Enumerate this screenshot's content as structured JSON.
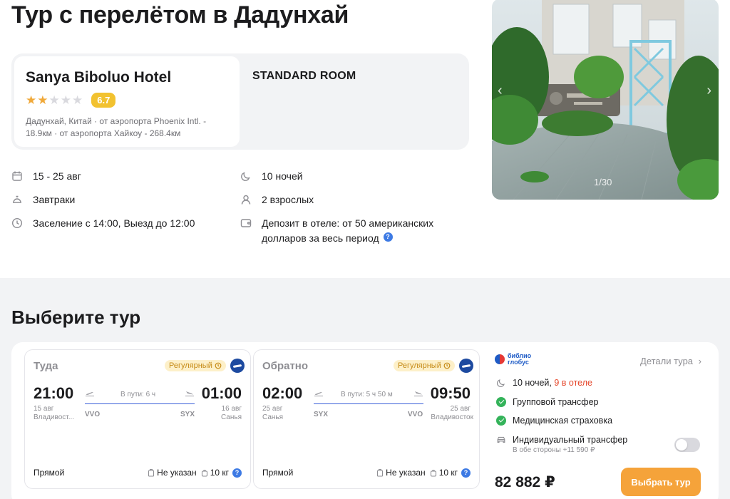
{
  "page": {
    "title": "Тур с перелётом в Дадунхай"
  },
  "hotel": {
    "name": "Sanya Biboluo Hotel",
    "stars": 2,
    "stars_max": 5,
    "score": "6.7",
    "location": "Дадунхай, Китай · от аэропорта Phoenix Intl. - 18.9км · от аэропорта Хайкоу - 268.4км",
    "room": "STANDARD ROOM"
  },
  "info": {
    "dates": "15 - 25 авг",
    "nights": "10 ночей",
    "meals": "Завтраки",
    "guests": "2 взрослых",
    "checkin": "Заселение с 14:00, Выезд до 12:00",
    "deposit": "Депозит в отеле: от 50 американских долларов за весь период",
    "deposit_help": "?"
  },
  "photo": {
    "counter": "1/30",
    "prev": "‹",
    "next": "›"
  },
  "section": {
    "title": "Выберите тур"
  },
  "outbound": {
    "label": "Туда",
    "badge": "Регулярный",
    "dep_time": "21:00",
    "dep_date": "15 авг",
    "dep_city": "Владивост...",
    "duration": "В пути: 6 ч",
    "dep_code": "VVO",
    "arr_code": "SYX",
    "arr_time": "01:00",
    "arr_date": "16 авг",
    "arr_city": "Санья",
    "type": "Прямой",
    "baggage": "Не указан",
    "hand": "10 кг",
    "help": "?"
  },
  "inbound": {
    "label": "Обратно",
    "badge": "Регулярный",
    "dep_time": "02:00",
    "dep_date": "25 авг",
    "dep_city": "Санья",
    "duration": "В пути: 5 ч 50 м",
    "dep_code": "SYX",
    "arr_code": "VVO",
    "arr_time": "09:50",
    "arr_date": "25 авг",
    "arr_city": "Владивосток",
    "type": "Прямой",
    "baggage": "Не указан",
    "hand": "10 кг",
    "help": "?"
  },
  "summary": {
    "operator_line1": "библио",
    "operator_line2": "глобус",
    "details": "Детали тура",
    "details_chevron": "›",
    "nights": "10 ночей,",
    "hotel_nights": "9 в отеле",
    "transfer": "Групповой трансфер",
    "insurance": "Медицинская страховка",
    "individual_transfer": "Индивидуальный трансфер",
    "individual_transfer_sub": "В обе стороны +11 590 ₽",
    "individual_transfer_on": false,
    "price": "82 882 ₽",
    "button": "Выбрать тур"
  },
  "colors": {
    "accent": "#f5a33a",
    "score": "#f2c230",
    "link": "#3d7ae4",
    "check": "#34b35a"
  }
}
